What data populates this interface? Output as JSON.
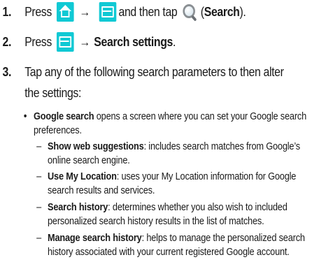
{
  "steps": [
    {
      "num": "1.",
      "pre": "Press",
      "arrow": "→",
      "mid": "and then tap",
      "bold": "Search",
      "open": "(",
      "close": ")."
    },
    {
      "num": "2.",
      "pre": "Press",
      "arrow": "→",
      "bold": "Search settings",
      "close": "."
    },
    {
      "num": "3.",
      "line1": "Tap any of the following search parameters to then alter",
      "line2": "the settings:"
    }
  ],
  "bullet": {
    "mark": "•",
    "term": "Google search",
    "text": " opens a screen where you can set your Google search preferences."
  },
  "subitems": [
    {
      "mark": "–",
      "term": "Show web suggestions",
      "text": ": includes search matches from Google’s online search engine."
    },
    {
      "mark": "–",
      "term": "Use My Location",
      "text": ": uses your My Location information for Google search results and services."
    },
    {
      "mark": "–",
      "term": "Search history",
      "text": ": determines whether you also wish to included personalized search history results in the list of matches."
    },
    {
      "mark": "–",
      "term": "Manage search history",
      "text": ": helps to manage the personalized search history associated with your current registered Google account."
    }
  ],
  "icons": {
    "home": "home-key-icon",
    "menu": "menu-key-icon",
    "search": "search-lens-icon",
    "key_color": "#10c9d4"
  }
}
